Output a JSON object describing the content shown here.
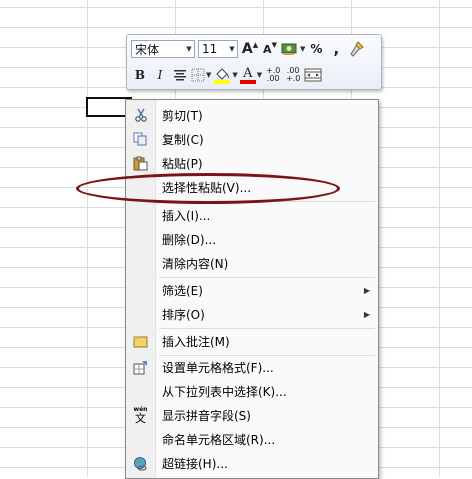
{
  "mini_toolbar": {
    "font_name": "宋体",
    "font_size": "11",
    "grow_font": "A",
    "shrink_font": "A",
    "percent": "%",
    "comma": ",",
    "bold": "B",
    "italic": "I",
    "increase_decimal": "+.0\n.00",
    "decrease_decimal": ".00\n+.0",
    "font_color_letter": "A"
  },
  "context_menu": {
    "items": [
      {
        "label": "剪切(T)",
        "icon": "scissors-icon"
      },
      {
        "label": "复制(C)",
        "icon": "copy-icon"
      },
      {
        "label": "粘贴(P)",
        "icon": "paste-icon"
      },
      {
        "label": "选择性粘贴(V)...",
        "icon": ""
      },
      {
        "label": "插入(I)...",
        "icon": ""
      },
      {
        "label": "删除(D)...",
        "icon": ""
      },
      {
        "label": "清除内容(N)",
        "icon": ""
      },
      {
        "label": "筛选(E)",
        "icon": "",
        "submenu": true
      },
      {
        "label": "排序(O)",
        "icon": "",
        "submenu": true
      },
      {
        "label": "插入批注(M)",
        "icon": "comment-icon"
      },
      {
        "label": "设置单元格格式(F)...",
        "icon": "format-cells-icon"
      },
      {
        "label": "从下拉列表中选择(K)...",
        "icon": ""
      },
      {
        "label": "显示拼音字段(S)",
        "icon": "phonetic-icon"
      },
      {
        "label": "命名单元格区域(R)...",
        "icon": ""
      },
      {
        "label": "超链接(H)...",
        "icon": "hyperlink-icon"
      }
    ],
    "submenu_arrow": "▶",
    "phonetic_icon_text": "wén",
    "phonetic_icon_char": "文"
  },
  "colors": {
    "highlight_ring": "#7a1418",
    "fill_color_bar": "#ffff00",
    "font_color_bar": "#e00000"
  }
}
